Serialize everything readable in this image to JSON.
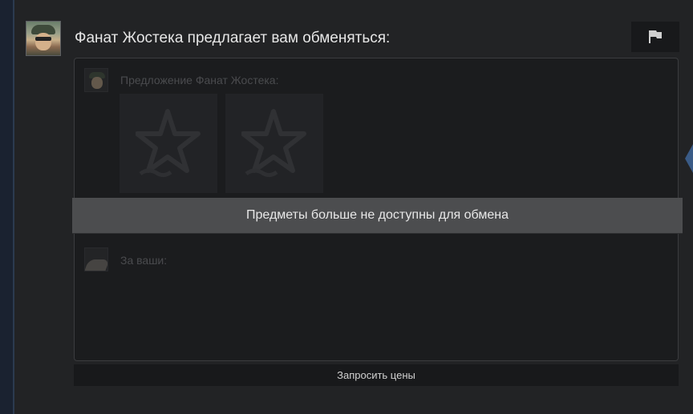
{
  "header": {
    "title": "Фанат Жостека предлагает вам обменяться:",
    "report_icon": "flag-icon"
  },
  "offer": {
    "their_label": "Предложение Фанат Жостека:",
    "your_label": "За ваши:",
    "items": [
      {
        "icon": "star-item-icon"
      },
      {
        "icon": "star-item-icon"
      }
    ]
  },
  "overlay": {
    "message": "Предметы больше не доступны для обмена"
  },
  "footer": {
    "request_prices_label": "Запросить цены"
  },
  "colors": {
    "background": "#222325",
    "banner": "#4c4d4f",
    "accent_tab": "#3a5b86"
  }
}
